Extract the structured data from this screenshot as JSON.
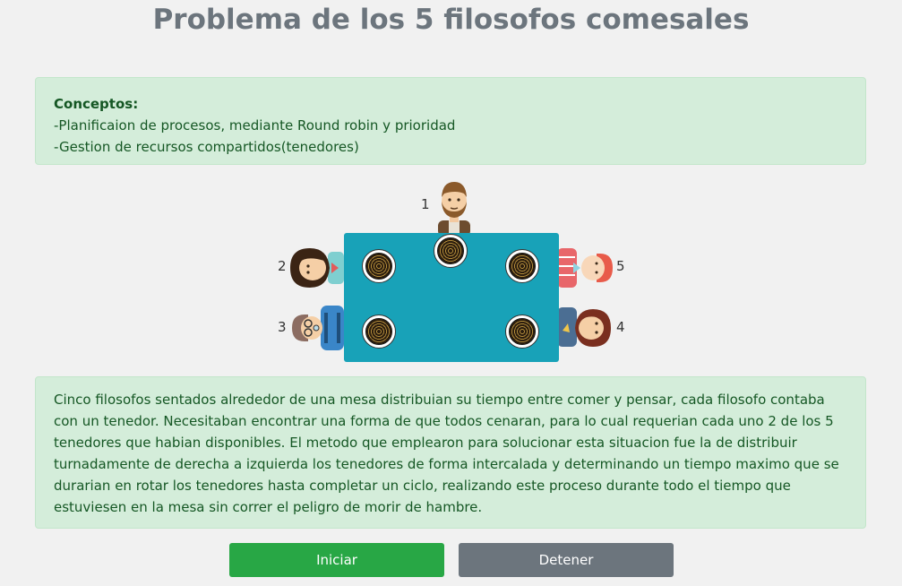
{
  "page": {
    "title": "Problema de los 5 filosofos comesales"
  },
  "concepts": {
    "heading": "Conceptos:",
    "lines": [
      "-Planificaion de procesos, mediante Round robin y prioridad",
      "-Gestion de recursos compartidos(tenedores)"
    ]
  },
  "philosophers": [
    {
      "number": "1",
      "icon": "philosopher-bearded-man-icon"
    },
    {
      "number": "2",
      "icon": "philosopher-long-hair-woman-icon"
    },
    {
      "number": "3",
      "icon": "philosopher-glasses-man-icon"
    },
    {
      "number": "4",
      "icon": "philosopher-brown-hair-woman-icon"
    },
    {
      "number": "5",
      "icon": "philosopher-red-hair-man-icon"
    }
  ],
  "description": "Cinco filosofos sentados alrededor de una mesa distribuian su tiempo entre comer y pensar, cada filosofo contaba con un tenedor. Necesitaban encontrar una forma de que todos cenaran, para lo cual requerian cada uno 2 de los 5 tenedores que habian disponibles. El metodo que emplearon para solucionar esta situacion fue la de distribuir turnadamente de derecha a izquierda los tenedores de forma intercalada y determinando un tiempo maximo que se durarian en rotar los tenedores hasta completar un ciclo, realizando este proceso durante todo el tiempo que estuviesen en la mesa sin correr el peligro de morir de hambre.",
  "buttons": {
    "start": "Iniciar",
    "stop": "Detener"
  },
  "colors": {
    "alert_bg": "#d4edda",
    "alert_text": "#155724",
    "table": "#18a2b8",
    "start": "#28a745",
    "stop": "#6c757d"
  }
}
